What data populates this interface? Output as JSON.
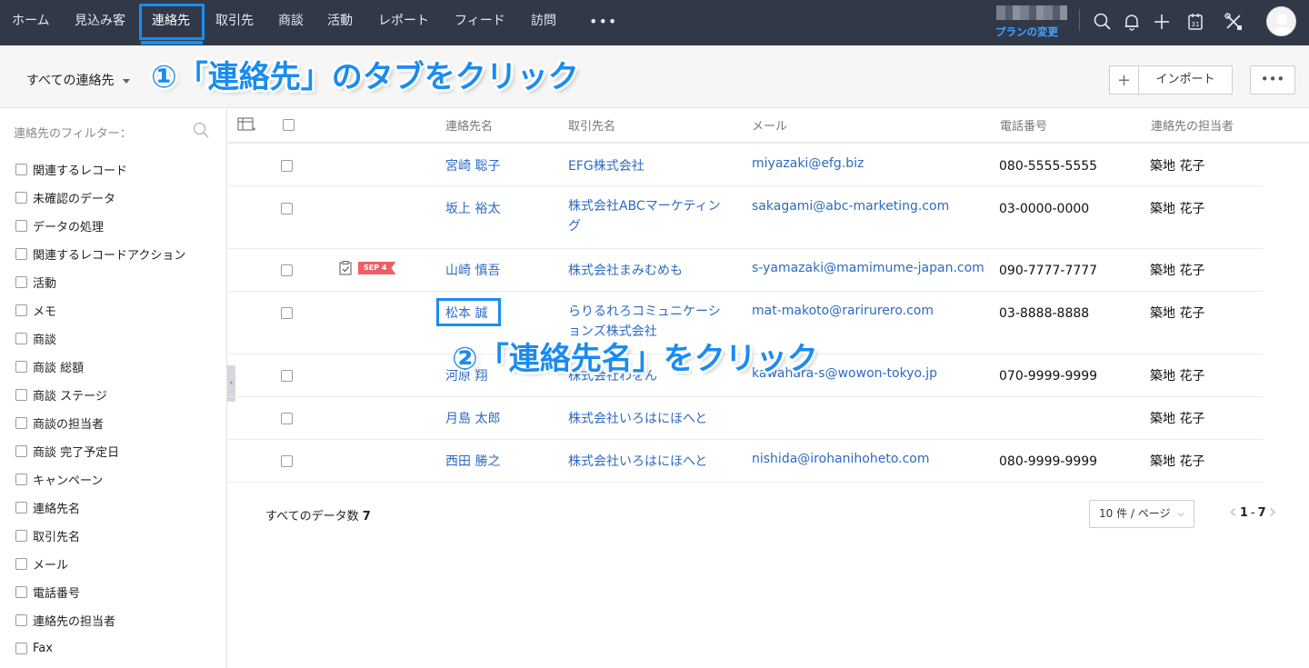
{
  "topnav": {
    "tabs": [
      {
        "label": "ホーム"
      },
      {
        "label": "見込み客"
      },
      {
        "label": "連絡先"
      },
      {
        "label": "取引先"
      },
      {
        "label": "商談"
      },
      {
        "label": "活動"
      },
      {
        "label": "レポート"
      },
      {
        "label": "フィード"
      },
      {
        "label": "訪問"
      }
    ],
    "more": "•••",
    "plan_link": "プランの変更",
    "calendar_day": "31"
  },
  "subheader": {
    "view": "すべての連絡先",
    "plus": "+",
    "import_label": "インポート",
    "more": "•••"
  },
  "annotations": {
    "step1": "①「連絡先」のタブをクリック",
    "step2": "②「連絡先名」をクリック"
  },
  "sidebar": {
    "title": "連絡先のフィルター：",
    "filters": [
      "関連するレコード",
      "未確認のデータ",
      "データの処理",
      "関連するレコードアクション",
      "活動",
      "メモ",
      "商談",
      "商談 総額",
      "商談 ステージ",
      "商談の担当者",
      "商談 完了予定日",
      "キャンペーン",
      "連絡先名",
      "取引先名",
      "メール",
      "電話番号",
      "連絡先の担当者",
      "Fax"
    ]
  },
  "table": {
    "columns": {
      "name": "連絡先名",
      "account": "取引先名",
      "email": "メール",
      "phone": "電話番号",
      "owner": "連絡先の担当者"
    },
    "rows": [
      {
        "name": "宮崎 聡子",
        "account": "EFG株式会社",
        "email": "miyazaki@efg.biz",
        "phone": "080-5555-5555",
        "owner": "築地 花子"
      },
      {
        "name": "坂上 裕太",
        "account": "株式会社ABCマーケティング",
        "email": "sakagami@abc-marketing.com",
        "phone": "03-0000-0000",
        "owner": "築地 花子"
      },
      {
        "name": "山崎 慎吾",
        "account": "株式会社まみむめも",
        "email": "s-yamazaki@mamimume-japan.com",
        "phone": "090-7777-7777",
        "owner": "築地 花子",
        "tag": "SEP 4"
      },
      {
        "name": "松本 誠",
        "account": "らりるれろコミュニケーションズ株式会社",
        "email": "mat-makoto@rarirurero.com",
        "phone": "03-8888-8888",
        "owner": "築地 花子"
      },
      {
        "name": "河原 翔",
        "account": "株式会社わをん",
        "email": "kawahara-s@wowon-tokyo.jp",
        "phone": "070-9999-9999",
        "owner": "築地 花子"
      },
      {
        "name": "月島 太郎",
        "account": "株式会社いろはにほへと",
        "email": "",
        "phone": "",
        "owner": "築地 花子"
      },
      {
        "name": "西田 勝之",
        "account": "株式会社いろはにほへと",
        "email": "nishida@irohanihoheto.com",
        "phone": "080-9999-9999",
        "owner": "築地 花子"
      }
    ]
  },
  "footer": {
    "total_label": "すべてのデータ数",
    "total_count": "7",
    "per_page": "10 件 / ページ",
    "page_start": "1",
    "page_dash": "-",
    "page_end": "7"
  }
}
